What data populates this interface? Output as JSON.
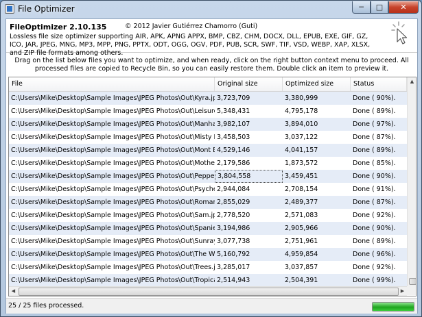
{
  "window": {
    "title": "File Optimizer",
    "controls": {
      "minimize": "─",
      "maximize": "□",
      "close": "✕"
    }
  },
  "header": {
    "app_name": "FileOptimizer 2.10.135",
    "copyright": "© 2012 Javier Gutiérrez Chamorro (Guti)",
    "description": "Lossless file size optimizer supporting AIR, APK, APNG APPX, BMP, CBZ, CHM, DOCX, DLL, EPUB, EXE, GIF, GZ, ICO, JAR, JPEG, MNG, MP3, MPP, PNG, PPTX, ODT, OGG, OGV, PDF, PUB, SCR, SWF, TIF, VSD, WEBP, XAP, XLSX, and ZIP file formats among others.",
    "icon": "cursor-click-icon"
  },
  "instructions": "Drag on the list below files you want to optimize, and when ready, click on the right button context menu to proceed. All processed files are copied to Recycle Bin, so you can easily restore them. Double click an item to preview it.",
  "table": {
    "columns": [
      "File",
      "Original size",
      "Optimized size",
      "Status"
    ],
    "rows": [
      [
        "C:\\Users\\Mike\\Desktop\\Sample Images\\JPEG Photos\\Out\\Kyra.jpg",
        "3,723,709",
        "3,380,999",
        "Done ( 90%)."
      ],
      [
        "C:\\Users\\Mike\\Desktop\\Sample Images\\JPEG Photos\\Out\\Leisure.jpg",
        "5,348,431",
        "4,795,178",
        "Done ( 89%)."
      ],
      [
        "C:\\Users\\Mike\\Desktop\\Sample Images\\JPEG Photos\\Out\\Manhattan.jpg",
        "3,982,107",
        "3,894,010",
        "Done ( 97%)."
      ],
      [
        "C:\\Users\\Mike\\Desktop\\Sample Images\\JPEG Photos\\Out\\Misty Picnic.jpg",
        "3,458,503",
        "3,037,122",
        "Done ( 87%)."
      ],
      [
        "C:\\Users\\Mike\\Desktop\\Sample Images\\JPEG Photos\\Out\\Mont Blanc.jpg",
        "4,529,146",
        "4,041,157",
        "Done ( 89%)."
      ],
      [
        "C:\\Users\\Mike\\Desktop\\Sample Images\\JPEG Photos\\Out\\Mother Goose.jpg",
        "2,179,586",
        "1,873,572",
        "Done ( 85%)."
      ],
      [
        "C:\\Users\\Mike\\Desktop\\Sample Images\\JPEG Photos\\Out\\Peppers.jpg",
        "3,804,558",
        "3,459,451",
        "Done ( 90%)."
      ],
      [
        "C:\\Users\\Mike\\Desktop\\Sample Images\\JPEG Photos\\Out\\Psychedelic.jpg",
        "2,944,084",
        "2,708,154",
        "Done ( 91%)."
      ],
      [
        "C:\\Users\\Mike\\Desktop\\Sample Images\\JPEG Photos\\Out\\Romantic.jpg",
        "2,855,029",
        "2,489,377",
        "Done ( 87%)."
      ],
      [
        "C:\\Users\\Mike\\Desktop\\Sample Images\\JPEG Photos\\Out\\Sam.jpg",
        "2,778,520",
        "2,571,083",
        "Done ( 92%)."
      ],
      [
        "C:\\Users\\Mike\\Desktop\\Sample Images\\JPEG Photos\\Out\\Spaniels.jpg",
        "3,194,986",
        "2,905,966",
        "Done ( 90%)."
      ],
      [
        "C:\\Users\\Mike\\Desktop\\Sample Images\\JPEG Photos\\Out\\Sunrays.jpg",
        "3,077,738",
        "2,751,961",
        "Done ( 89%)."
      ],
      [
        "C:\\Users\\Mike\\Desktop\\Sample Images\\JPEG Photos\\Out\\The Way.jpg",
        "5,160,792",
        "4,959,854",
        "Done ( 96%)."
      ],
      [
        "C:\\Users\\Mike\\Desktop\\Sample Images\\JPEG Photos\\Out\\Trees.jpg",
        "3,285,017",
        "3,037,857",
        "Done ( 92%)."
      ],
      [
        "C:\\Users\\Mike\\Desktop\\Sample Images\\JPEG Photos\\Out\\Tropical.jpg",
        "2,514,943",
        "2,504,391",
        "Done ( 99%)."
      ]
    ],
    "focused_row": 6,
    "alt_row_color": "#e5ecf7"
  },
  "scrollbars": {
    "up": "▲",
    "down": "▼",
    "left": "◀",
    "right": "▶"
  },
  "status": {
    "text": "25 / 25 files processed.",
    "progress": 1.0,
    "progress_color": "#1ea51e"
  }
}
